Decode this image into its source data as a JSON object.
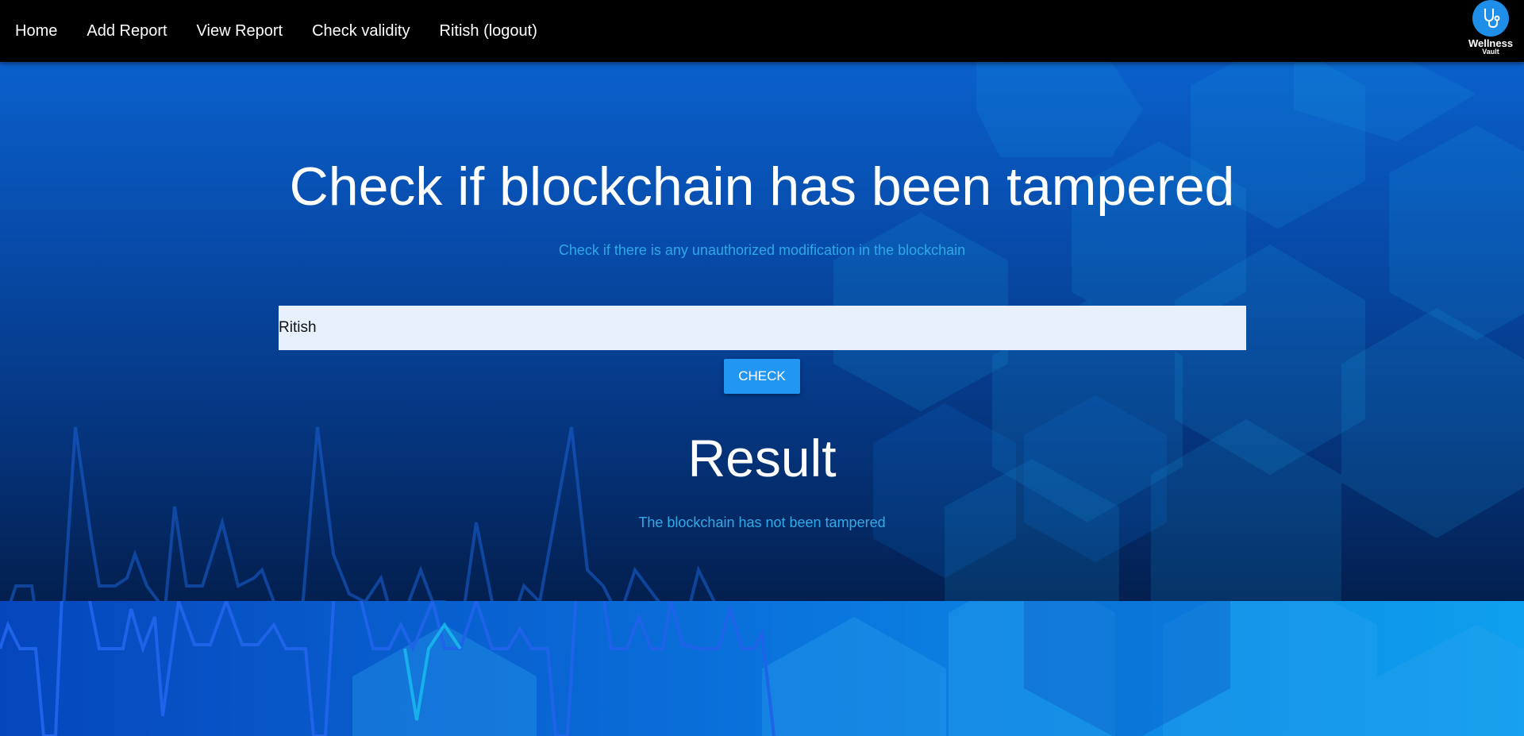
{
  "nav": {
    "links": [
      "Home",
      "Add Report",
      "View Report",
      "Check validity",
      "Ritish (logout)"
    ]
  },
  "brand": {
    "name": "Wellness",
    "sub": "Vault",
    "icon": "stethoscope-icon"
  },
  "main": {
    "title": "Check if blockchain has been tampered",
    "subtitle": "Check if there is any unauthorized modification in the blockchain",
    "input_value": "Ritish",
    "button_label": "CHECK",
    "result_title": "Result",
    "result_text": "The blockchain has not been tampered"
  },
  "colors": {
    "navbar": "#000000",
    "accent_button": "#2196f3",
    "subtitle_text": "#2fa8e8",
    "input_bg": "#e8f0fd"
  }
}
